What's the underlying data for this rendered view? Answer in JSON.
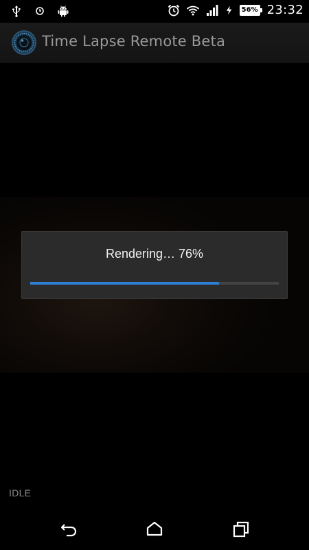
{
  "status_bar": {
    "icons_left": [
      "usb-icon",
      "alarm-off-icon",
      "android-debug-icon"
    ],
    "icons_right": [
      "alarm-clock-icon",
      "wifi-icon",
      "signal-icon",
      "charging-icon"
    ],
    "battery": "56%",
    "time": "23:32"
  },
  "app_bar": {
    "logo": "camera-lens-icon",
    "title": "Time Lapse Remote Beta"
  },
  "dialog": {
    "message": "Rendering… 76%",
    "progress": 0.76,
    "accent_color": "#2f7fd6"
  },
  "status": {
    "label": "IDLE"
  },
  "nav_bar": {
    "buttons": [
      "back-icon",
      "home-icon",
      "recents-icon"
    ]
  }
}
